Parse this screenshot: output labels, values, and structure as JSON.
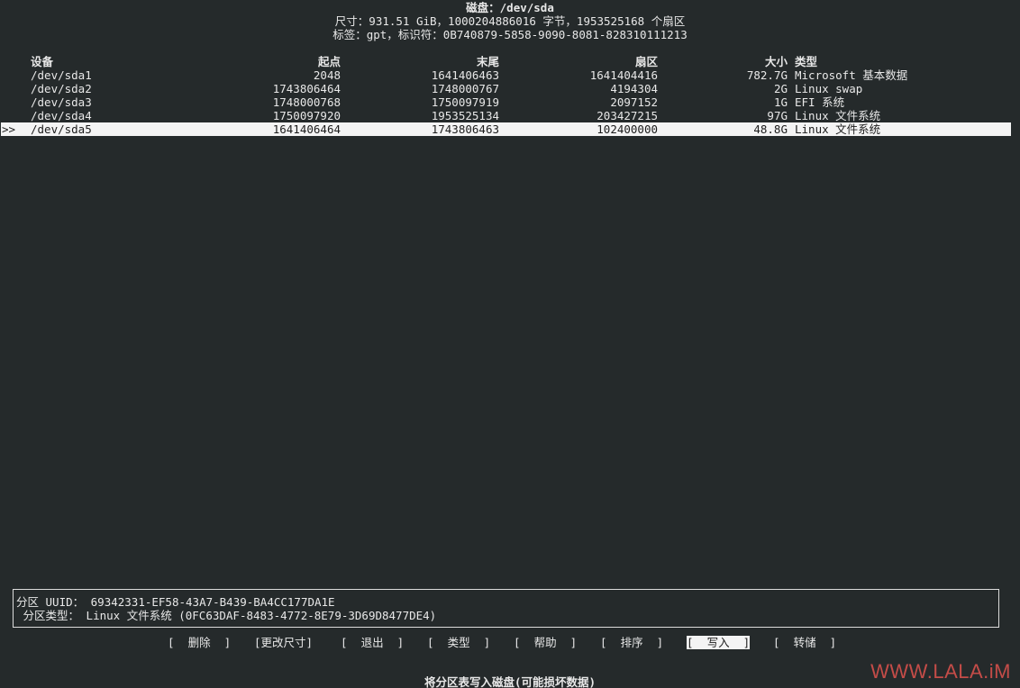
{
  "header": {
    "disk_title": "磁盘：/dev/sda",
    "size_line": "尺寸：931.51 GiB，1000204886016 字节，1953525168 个扇区",
    "label_line": "标签：gpt，标识符：0B740879-5858-9090-8081-828310111213"
  },
  "table": {
    "columns": {
      "device": "设备",
      "start": "起点",
      "end": "末尾",
      "sectors": "扇区",
      "size": "大小",
      "type": "类型"
    },
    "rows": [
      {
        "marker": "",
        "device": "/dev/sda1",
        "start": "2048",
        "end": "1641406463",
        "sectors": "1641404416",
        "size": "782.7G",
        "type": "Microsoft 基本数据"
      },
      {
        "marker": "",
        "device": "/dev/sda2",
        "start": "1743806464",
        "end": "1748000767",
        "sectors": "4194304",
        "size": "2G",
        "type": "Linux swap"
      },
      {
        "marker": "",
        "device": "/dev/sda3",
        "start": "1748000768",
        "end": "1750097919",
        "sectors": "2097152",
        "size": "1G",
        "type": "EFI 系统"
      },
      {
        "marker": "",
        "device": "/dev/sda4",
        "start": "1750097920",
        "end": "1953525134",
        "sectors": "203427215",
        "size": "97G",
        "type": "Linux 文件系统"
      },
      {
        "marker": ">>",
        "device": "/dev/sda5",
        "start": "1641406464",
        "end": "1743806463",
        "sectors": "102400000",
        "size": "48.8G",
        "type": "Linux 文件系统"
      }
    ]
  },
  "info": {
    "uuid_line": "分区 UUID： 69342331-EF58-43A7-B439-BA4CC177DA1E",
    "type_line": " 分区类型： Linux 文件系统 (0FC63DAF-8483-4772-8E79-3D69D8477DE4)"
  },
  "menu": {
    "items": [
      "[  删除  ]",
      "[更改尺寸]",
      "[  退出  ]",
      "[  类型  ]",
      "[  帮助  ]",
      "[  排序  ]",
      "[  写入  ]",
      "[  转储  ]"
    ],
    "active_index": 6
  },
  "help_text": "将分区表写入磁盘(可能损坏数据)",
  "watermark": "WWW.LALA.iM",
  "colors": {
    "background": "#252a2b",
    "text": "#e8e8e8",
    "highlight_bg": "#f4f4f4",
    "highlight_text": "#1c1c1c",
    "watermark": "#c44c48"
  }
}
